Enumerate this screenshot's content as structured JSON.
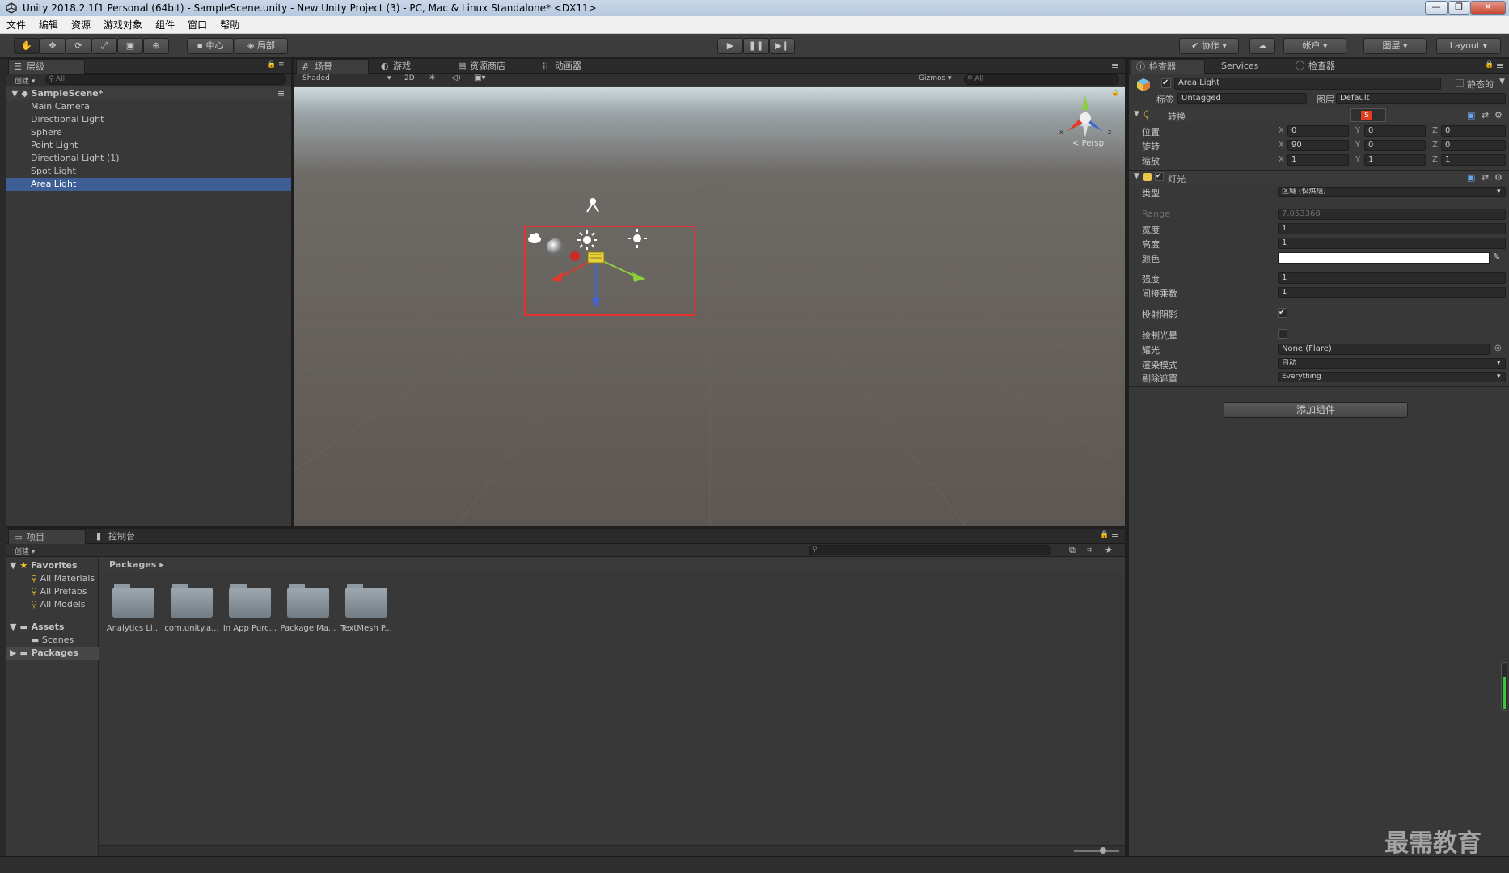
{
  "window": {
    "title": "Unity 2018.2.1f1 Personal (64bit) - SampleScene.unity - New Unity Project (3) - PC, Mac & Linux Standalone* <DX11>"
  },
  "menu": [
    "文件",
    "编辑",
    "资源",
    "游戏对象",
    "组件",
    "窗口",
    "帮助"
  ],
  "toolbar": {
    "pivot": "中心",
    "space": "局部",
    "collab": "协作",
    "account": "帐户",
    "layers": "图层",
    "layout": "Layout"
  },
  "hierarchy": {
    "tab": "层级",
    "create": "创建",
    "search_placeholder": "All",
    "scene_name": "SampleScene*",
    "items": [
      "Main Camera",
      "Directional Light",
      "Sphere",
      "Point Light",
      "Directional Light (1)",
      "Spot Light",
      "Area Light"
    ],
    "selected_index": 6
  },
  "scene": {
    "tabs": [
      "场景",
      "游戏",
      "资源商店",
      "动画器"
    ],
    "shading": "Shaded",
    "mode_2d": "2D",
    "gizmos": "Gizmos",
    "search_placeholder": "All",
    "persp": "Persp",
    "axis_x": "x",
    "axis_z": "z"
  },
  "project": {
    "tabs": [
      "项目",
      "控制台"
    ],
    "create": "创建",
    "favorites_label": "Favorites",
    "favorites": [
      "All Materials",
      "All Prefabs",
      "All Models"
    ],
    "assets_label": "Assets",
    "assets_children": [
      "Scenes"
    ],
    "packages_label": "Packages",
    "breadcrumb": "Packages",
    "folders": [
      "Analytics Li...",
      "com.unity.a...",
      "In App Purc...",
      "Package Ma...",
      "TextMesh P..."
    ]
  },
  "inspector": {
    "tabs": [
      "检查器",
      "Services",
      "检查器"
    ],
    "object_name": "Area Light",
    "static_label": "静态的",
    "tag_label": "标签",
    "tag_value": "Untagged",
    "layer_label": "图层",
    "layer_value": "Default",
    "transform": {
      "title": "转换",
      "position_label": "位置",
      "rotation_label": "旋转",
      "scale_label": "缩放",
      "position": [
        "0",
        "0",
        "0"
      ],
      "rotation": [
        "90",
        "0",
        "0"
      ],
      "scale": [
        "1",
        "1",
        "1"
      ],
      "axis_labels": [
        "X",
        "Y",
        "Z"
      ]
    },
    "light": {
      "title": "灯光",
      "type_label": "类型",
      "type_value": "区域 (仅烘焙)",
      "range_label": "Range",
      "range_value": "7.053368",
      "width_label": "宽度",
      "width_value": "1",
      "height_label": "高度",
      "height_value": "1",
      "color_label": "颜色",
      "color_value": "#ffffff",
      "intensity_label": "强度",
      "intensity_value": "1",
      "indirect_label": "间接乘数",
      "indirect_value": "1",
      "shadows_label": "投射阴影",
      "shadows_checked": true,
      "halo_label": "绘制光晕",
      "halo_checked": false,
      "flare_label": "耀光",
      "flare_value": "None (Flare)",
      "render_mode_label": "渲染模式",
      "render_mode_value": "自动",
      "culling_label": "剔除遮罩",
      "culling_value": "Everything"
    },
    "add_component": "添加组件"
  },
  "watermark": "最需教育",
  "colors": {
    "selection": "#3e5f96",
    "highlight_box": "#e8312f",
    "axis_red": "#e03a2a",
    "axis_green": "#8ccf3a",
    "axis_blue": "#3d64d8"
  }
}
